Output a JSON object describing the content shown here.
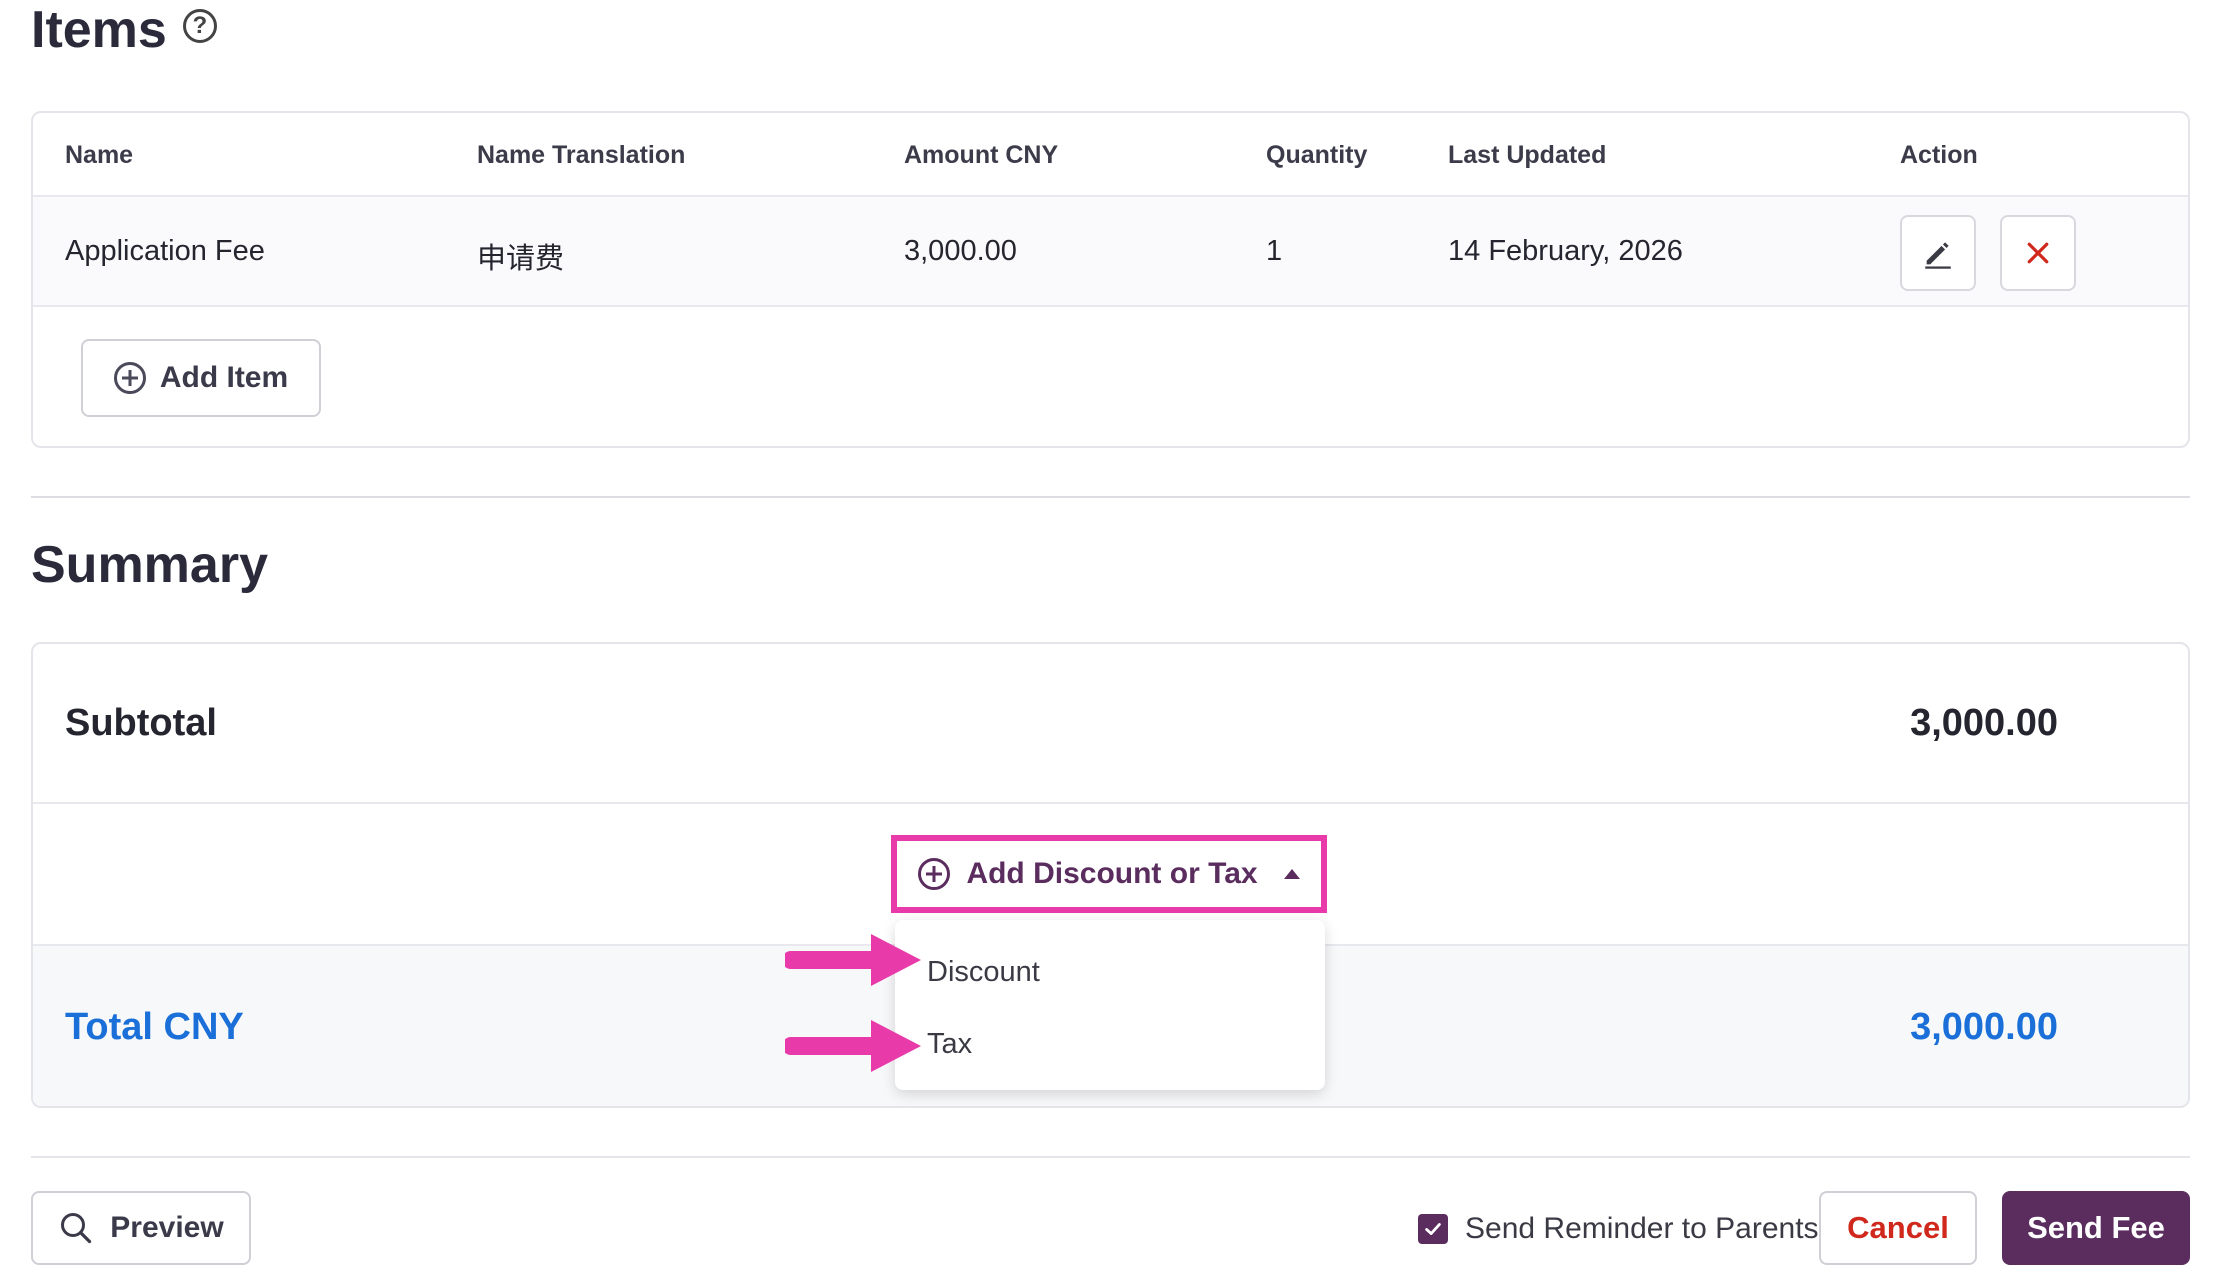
{
  "items_section": {
    "title": "Items",
    "help_icon": "question-circle-icon",
    "columns": [
      "Name",
      "Name Translation",
      "Amount CNY",
      "Quantity",
      "Last Updated",
      "Action"
    ],
    "rows": [
      {
        "name": "Application Fee",
        "name_translation": "申请费",
        "amount": "3,000.00",
        "quantity": "1",
        "last_updated": "14 February, 2026",
        "edit_icon": "pencil-icon",
        "delete_icon": "close-icon"
      }
    ],
    "add_item_label": "Add Item"
  },
  "summary": {
    "title": "Summary",
    "subtotal_label": "Subtotal",
    "subtotal_value": "3,000.00",
    "add_discount_label": "Add Discount or Tax",
    "dropdown_options": [
      "Discount",
      "Tax"
    ],
    "total_label": "Total CNY",
    "total_value": "3,000.00"
  },
  "footer": {
    "preview_label": "Preview",
    "reminder_label": "Send Reminder to Parents",
    "reminder_checked": true,
    "cancel_label": "Cancel",
    "send_label": "Send Fee"
  },
  "colors": {
    "brand": "#5a2d5e",
    "highlight": "#e83aa8",
    "total_blue": "#1a6fd8",
    "cancel_red": "#d0281c"
  }
}
